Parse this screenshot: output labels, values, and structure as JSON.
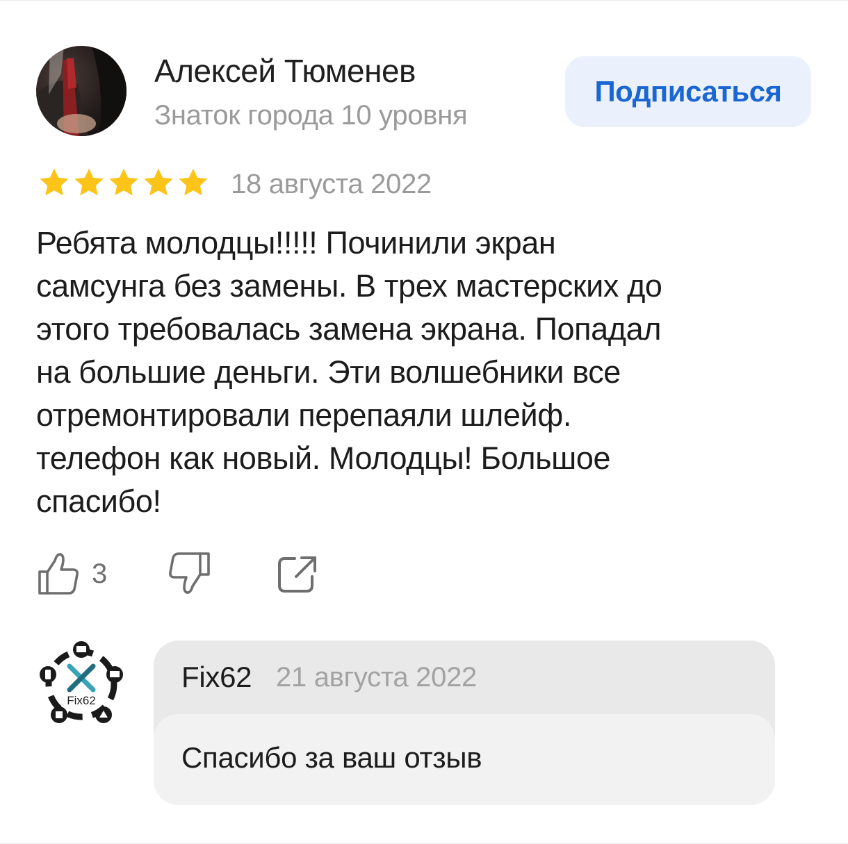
{
  "review": {
    "author": {
      "name": "Алексей Тюменев",
      "rank": "Знаток города 10 уровня",
      "avatar_icon": "user-photo"
    },
    "subscribe_label": "Подписаться",
    "rating": {
      "value": 5,
      "max": 5,
      "color": "#fcc419"
    },
    "date": "18 августа 2022",
    "text": "Ребята молодцы!!!!! Починили экран\nсамсунга без замены. В трех мастерских до\nэтого требовалась замена экрана. Попадал\nна большие деньги. Эти волшебники все\nотремонтировали перепаяли шлейф.\nтелефон как новый. Молодцы! Большое\nспасибо!",
    "actions": {
      "like_icon": "thumbs-up-icon",
      "like_count": "3",
      "dislike_icon": "thumbs-down-icon",
      "share_icon": "share-icon"
    }
  },
  "reply": {
    "author": "Fix62",
    "logo_text": "Fix62",
    "date": "21 августа 2022",
    "text": "Спасибо за ваш отзыв"
  },
  "colors": {
    "accent": "#1a66d2",
    "accent_bg": "#eaf1fc",
    "muted_text": "#9a9a9a",
    "logo_teal": "#3aa3b8"
  }
}
